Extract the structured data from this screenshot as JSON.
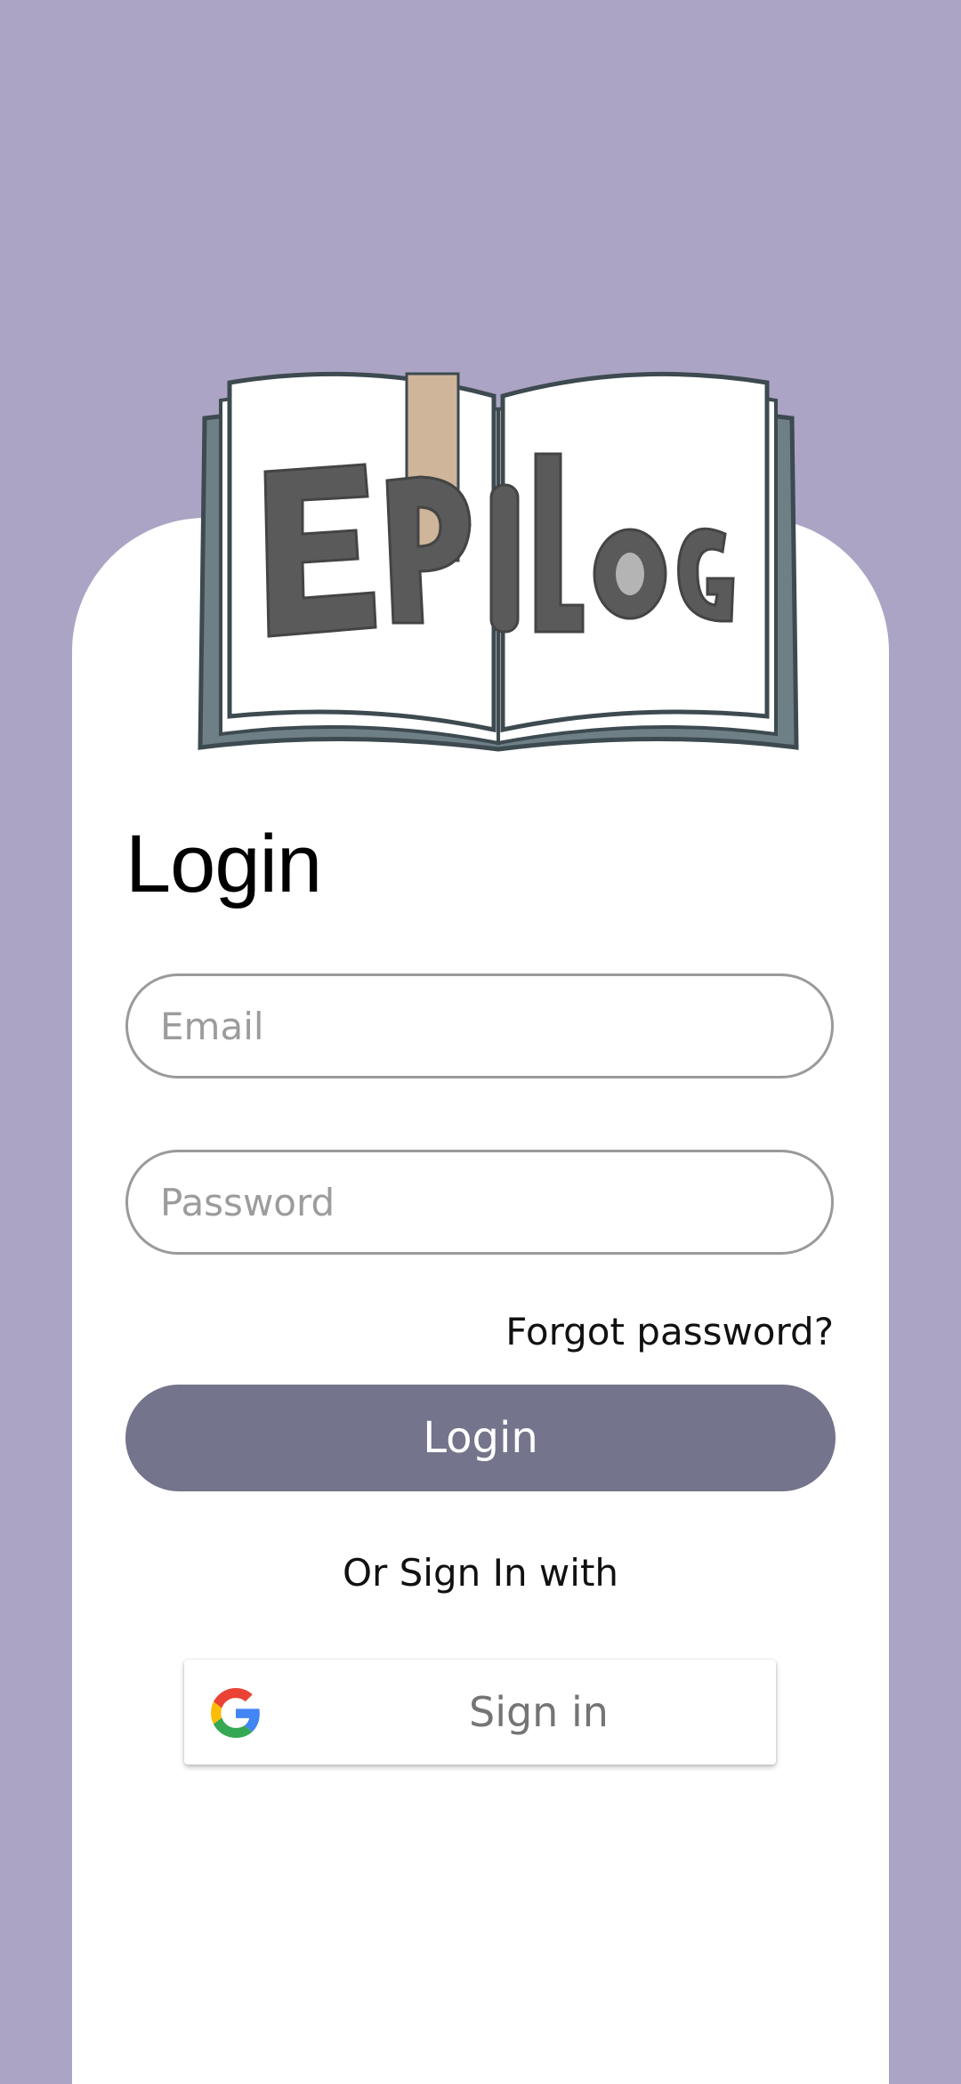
{
  "logo": {
    "text": "EPILOG"
  },
  "login": {
    "title": "Login",
    "email_placeholder": "Email",
    "password_placeholder": "Password",
    "forgot_label": "Forgot password?",
    "button_label": "Login",
    "or_text": "Or Sign In with"
  },
  "google": {
    "label": "Sign in",
    "icon": "google-g-icon"
  },
  "colors": {
    "background": "#aca4c4",
    "card": "#ffffff",
    "button": "#74748c",
    "input_border": "#9a9a9a"
  }
}
